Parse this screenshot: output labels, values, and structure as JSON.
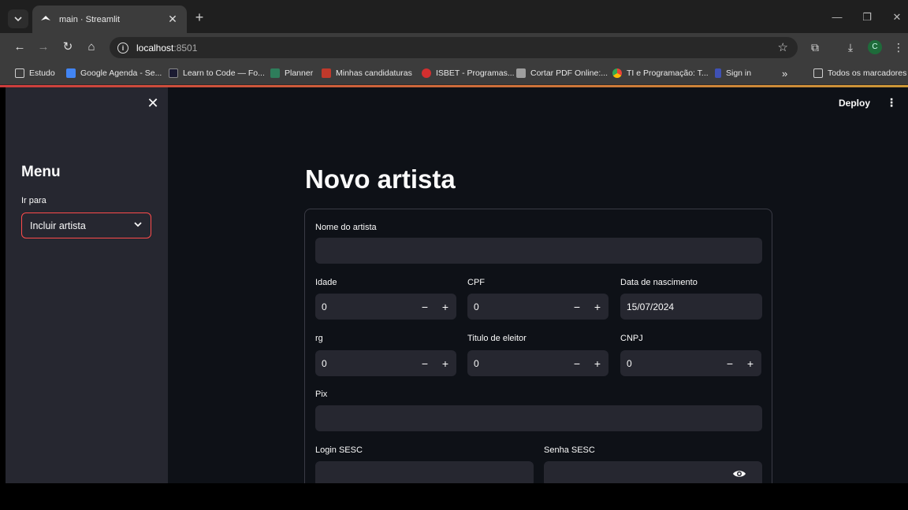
{
  "browser": {
    "tab_title": "main · Streamlit",
    "url_host": "localhost",
    "url_port": ":8501",
    "profile_initial": "C",
    "bookmarks": [
      {
        "label": "Estudo",
        "color": "#cfcfcf"
      },
      {
        "label": "Google Agenda - Se...",
        "color": "#4285f4"
      },
      {
        "label": "Learn to Code — Fo...",
        "color": "#1b1b32"
      },
      {
        "label": "Planner",
        "color": "#2e7d5b"
      },
      {
        "label": "Minhas candidaturas",
        "color": "#c0392b"
      },
      {
        "label": "ISBET - Programas...",
        "color": "#d32f2f"
      },
      {
        "label": "Cortar PDF Online:...",
        "color": "#9e9e9e"
      },
      {
        "label": "TI e Programação: T...",
        "color": "#ff6f00"
      },
      {
        "label": "Sign in",
        "color": "#3f51b5"
      }
    ],
    "bookmarks_all": "Todos os marcadores"
  },
  "sidebar": {
    "title": "Menu",
    "select_label": "Ir para",
    "select_value": "Incluir artista"
  },
  "header": {
    "deploy_label": "Deploy"
  },
  "main": {
    "title": "Novo artista",
    "fields": {
      "nome_label": "Nome do artista",
      "nome_value": "",
      "idade_label": "Idade",
      "idade_value": "0",
      "cpf_label": "CPF",
      "cpf_value": "0",
      "nascimento_label": "Data de nascimento",
      "nascimento_value": "15/07/2024",
      "rg_label": "rg",
      "rg_value": "0",
      "titulo_label": "Titulo de eleitor",
      "titulo_value": "0",
      "cnpj_label": "CNPJ",
      "cnpj_value": "0",
      "pix_label": "Pix",
      "pix_value": "",
      "login_label": "Login SESC",
      "login_value": "",
      "senha_label": "Senha SESC",
      "senha_value": ""
    }
  },
  "colors": {
    "accent": "#ff4b4b",
    "app_bg": "#0e1117",
    "sidebar_bg": "#262730"
  }
}
